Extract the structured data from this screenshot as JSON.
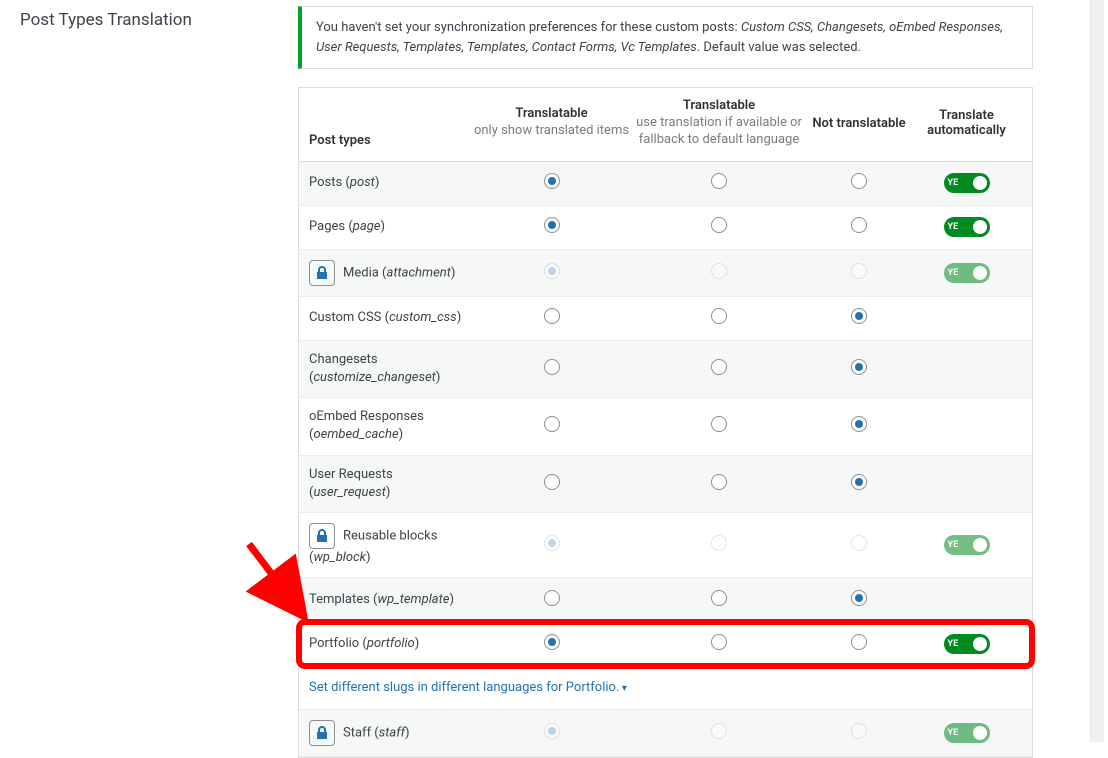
{
  "title": "Post Types Translation",
  "notice": {
    "prefix": "You haven't set your synchronization preferences for these custom posts: ",
    "items": "Custom CSS, Changesets, oEmbed Responses, User Requests, Templates, Templates, Contact Forms, Vc Templates",
    "suffix": ". Default value was selected."
  },
  "headers": {
    "post_types": "Post types",
    "col1_title": "Translatable",
    "col1_sub": "only show translated items",
    "col2_title": "Translatable",
    "col2_sub": "use translation if available or fallback to default language",
    "col3_title": "Not translatable",
    "col4_title": "Translate automatically"
  },
  "toggle_label": "YE",
  "rows": [
    {
      "label": "Posts",
      "slug": "post",
      "locked": false,
      "sel": 0,
      "toggle": true,
      "tdisabled": false
    },
    {
      "label": "Pages",
      "slug": "page",
      "locked": false,
      "sel": 0,
      "toggle": true,
      "tdisabled": false
    },
    {
      "label": "Media",
      "slug": "attachment",
      "locked": true,
      "sel": 0,
      "toggle": true,
      "tdisabled": true
    },
    {
      "label": "Custom CSS",
      "slug": "custom_css",
      "locked": false,
      "sel": 2,
      "toggle": false,
      "tdisabled": false
    },
    {
      "label": "Changesets",
      "slug": "customize_changeset",
      "locked": false,
      "sel": 2,
      "toggle": false,
      "tdisabled": false
    },
    {
      "label": "oEmbed Responses",
      "slug": "oembed_cache",
      "locked": false,
      "sel": 2,
      "toggle": false,
      "tdisabled": false
    },
    {
      "label": "User Requests",
      "slug": "user_request",
      "locked": false,
      "sel": 2,
      "toggle": false,
      "tdisabled": false
    },
    {
      "label": "Reusable blocks",
      "slug": "wp_block",
      "locked": true,
      "sel": 0,
      "toggle": true,
      "tdisabled": true
    },
    {
      "label": "Templates",
      "slug": "wp_template",
      "locked": false,
      "sel": 2,
      "toggle": false,
      "tdisabled": false
    },
    {
      "label": "Portfolio",
      "slug": "portfolio",
      "locked": false,
      "sel": 0,
      "toggle": true,
      "tdisabled": false
    },
    {
      "label": "Staff",
      "slug": "staff",
      "locked": true,
      "sel": 0,
      "toggle": true,
      "tdisabled": true
    }
  ],
  "slug_link": "Set different slugs in different languages for Portfolio."
}
